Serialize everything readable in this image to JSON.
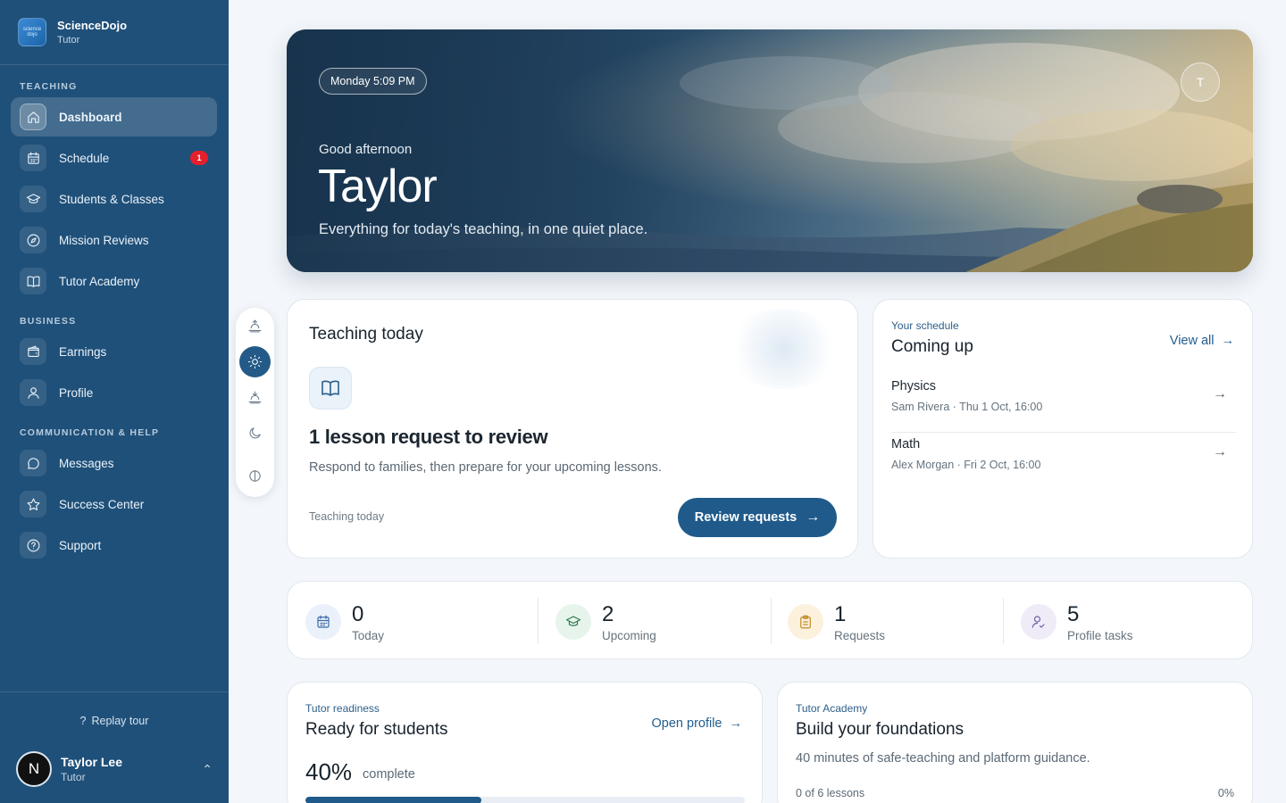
{
  "brand": {
    "name": "ScienceDojo",
    "role": "Tutor",
    "logo_text": "science dojo"
  },
  "sidebar": {
    "sections": {
      "teaching": "TEACHING",
      "business": "BUSINESS",
      "communication": "COMMUNICATION & HELP"
    },
    "items": [
      {
        "label": "Dashboard",
        "icon": "home-icon",
        "active": true
      },
      {
        "label": "Schedule",
        "icon": "calendar-icon",
        "badge": "1"
      },
      {
        "label": "Students & Classes",
        "icon": "graduation-cap-icon"
      },
      {
        "label": "Mission Reviews",
        "icon": "compass-icon"
      },
      {
        "label": "Tutor Academy",
        "icon": "book-icon"
      },
      {
        "label": "Earnings",
        "icon": "wallet-icon"
      },
      {
        "label": "Profile",
        "icon": "user-icon"
      },
      {
        "label": "Messages",
        "icon": "message-icon"
      },
      {
        "label": "Success Center",
        "icon": "star-icon"
      },
      {
        "label": "Support",
        "icon": "help-circle-icon"
      }
    ],
    "replay_tour": "Replay tour",
    "user": {
      "initial": "N",
      "name": "Taylor Lee",
      "role": "Tutor"
    }
  },
  "hero": {
    "time": "Monday 5:09 PM",
    "avatar_initial": "T",
    "greeting": "Good afternoon",
    "name": "Taylor",
    "tagline": "Everything for today's teaching, in one quiet place."
  },
  "theme_toolbar": {
    "buttons": [
      "sunrise-icon",
      "sun-icon",
      "sunset-icon",
      "moon-icon",
      "contrast-icon"
    ],
    "active": "sun-icon"
  },
  "teaching_today": {
    "title": "Teaching today",
    "headline": "1 lesson request to review",
    "description": "Respond to families, then prepare for your upcoming lessons.",
    "footer": "Teaching today",
    "button": "Review requests"
  },
  "schedule": {
    "overline": "Your schedule",
    "title": "Coming up",
    "view_all": "View all",
    "items": [
      {
        "subject": "Physics",
        "meta": "Sam Rivera · Thu 1 Oct, 16:00"
      },
      {
        "subject": "Math",
        "meta": "Alex Morgan · Fri 2 Oct, 16:00"
      }
    ]
  },
  "stats": [
    {
      "value": "0",
      "label": "Today",
      "icon": "calendar-icon",
      "color": "#3c6aa6",
      "bg": "#eaf1fa"
    },
    {
      "value": "2",
      "label": "Upcoming",
      "icon": "graduation-cap-icon",
      "color": "#2b7a4f",
      "bg": "#e7f4ec"
    },
    {
      "value": "1",
      "label": "Requests",
      "icon": "clipboard-icon",
      "color": "#c18a25",
      "bg": "#fcf1dd"
    },
    {
      "value": "5",
      "label": "Profile tasks",
      "icon": "user-check-icon",
      "color": "#6a5ca8",
      "bg": "#efecf8"
    }
  ],
  "readiness": {
    "overline": "Tutor readiness",
    "title": "Ready for students",
    "link": "Open profile",
    "percent": "40%",
    "percent_word": "complete",
    "progress": 0.4
  },
  "academy": {
    "overline": "Tutor Academy",
    "title": "Build your foundations",
    "description": "40 minutes of safe-teaching and platform guidance.",
    "lessons": "0 of 6 lessons",
    "percent": "0%"
  },
  "colors": {
    "sidebar": "#1f5079",
    "accent": "#1f5a8a",
    "badge": "#e51f2b"
  }
}
